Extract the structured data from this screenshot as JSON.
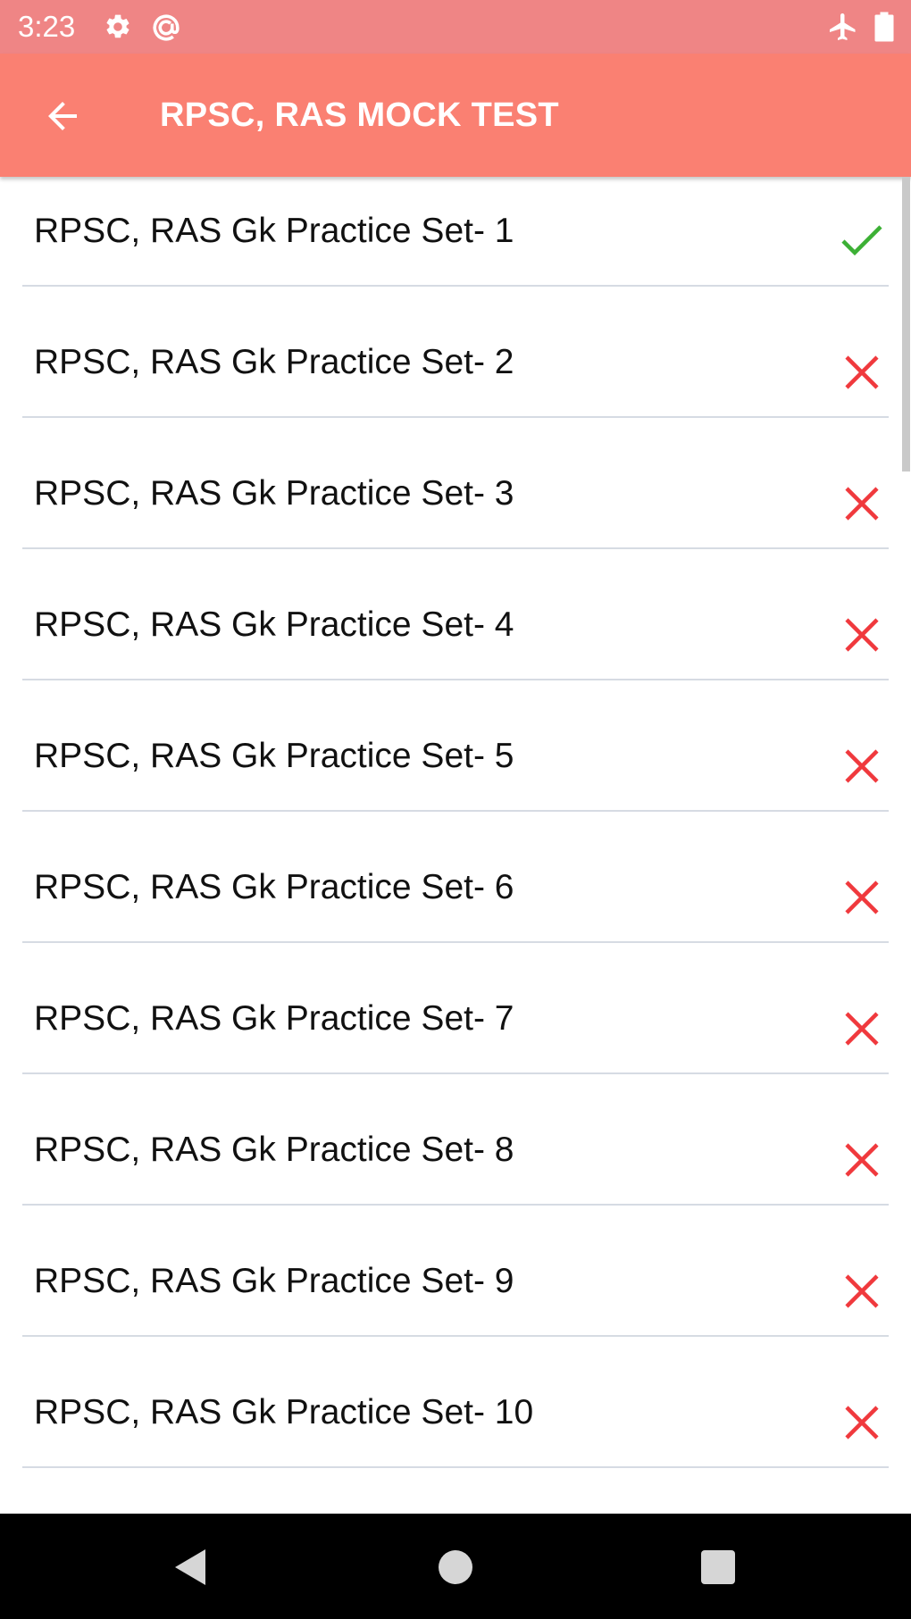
{
  "status_bar": {
    "time": "3:23",
    "icons_left": [
      "gear-icon",
      "at-sign-icon"
    ],
    "icons_right": [
      "airplane-icon",
      "battery-icon"
    ]
  },
  "app_bar": {
    "title": "RPSC, RAS MOCK TEST",
    "back_icon": "arrow-back-icon",
    "background": "#fa8072"
  },
  "list": {
    "items": [
      {
        "label": "RPSC, RAS Gk Practice Set- 1",
        "status": "completed",
        "icon": "check-icon"
      },
      {
        "label": "RPSC, RAS Gk Practice Set- 2",
        "status": "not-completed",
        "icon": "close-icon"
      },
      {
        "label": "RPSC, RAS Gk Practice Set- 3",
        "status": "not-completed",
        "icon": "close-icon"
      },
      {
        "label": "RPSC, RAS Gk Practice Set- 4",
        "status": "not-completed",
        "icon": "close-icon"
      },
      {
        "label": "RPSC, RAS Gk Practice Set- 5",
        "status": "not-completed",
        "icon": "close-icon"
      },
      {
        "label": "RPSC, RAS Gk Practice Set- 6",
        "status": "not-completed",
        "icon": "close-icon"
      },
      {
        "label": "RPSC, RAS Gk Practice Set- 7",
        "status": "not-completed",
        "icon": "close-icon"
      },
      {
        "label": "RPSC, RAS Gk Practice Set- 8",
        "status": "not-completed",
        "icon": "close-icon"
      },
      {
        "label": "RPSC, RAS Gk Practice Set- 9",
        "status": "not-completed",
        "icon": "close-icon"
      },
      {
        "label": "RPSC, RAS Gk Practice Set- 10",
        "status": "not-completed",
        "icon": "close-icon"
      }
    ]
  },
  "nav_bar": {
    "buttons": [
      "back-triangle-icon",
      "home-circle-icon",
      "recents-square-icon"
    ]
  },
  "colors": {
    "status_bar": "#ef8585",
    "app_bar": "#fa8072",
    "check": "#3cb035",
    "cross": "#f0393d",
    "divider": "#d6dbe3"
  }
}
